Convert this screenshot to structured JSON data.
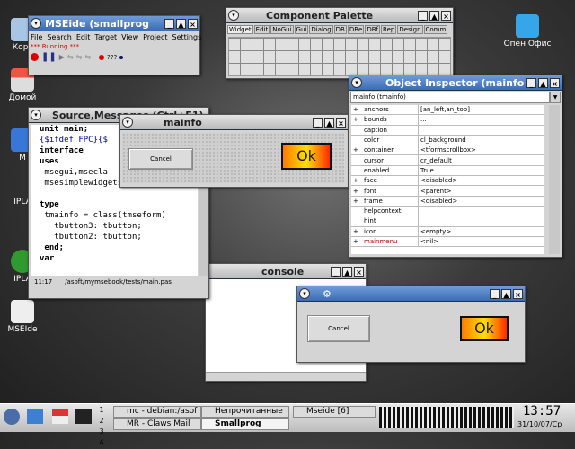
{
  "desktop": {
    "icons": [
      {
        "label": "Корз"
      },
      {
        "label": "Домой"
      },
      {
        "label": "M"
      },
      {
        "label": "IPLA"
      },
      {
        "label": "IPLA"
      },
      {
        "label": "MSEIde"
      },
      {
        "label": "Опен Офис"
      }
    ]
  },
  "mseide": {
    "title": "MSEide (smallprog",
    "menu": [
      "File",
      "Search",
      "Edit",
      "Target",
      "View",
      "Project",
      "Settings"
    ],
    "status": "*** Running ***",
    "toolbar_text": "???"
  },
  "palette": {
    "title": "Component Palette",
    "tabs": [
      "Widget",
      "Edit",
      "NoGui",
      "Gui",
      "Dialog",
      "DB",
      "DBe",
      "DBf",
      "Rep",
      "Design",
      "Comm"
    ]
  },
  "inspector": {
    "title": "Object Inspector (mainfo)",
    "selector": "mainfo (tmainfo)",
    "properties": [
      {
        "exp": "+",
        "name": "anchors",
        "value": "[an_left,an_top]"
      },
      {
        "exp": "+",
        "name": "bounds",
        "value": "..."
      },
      {
        "exp": "",
        "name": "caption",
        "value": ""
      },
      {
        "exp": "",
        "name": "color",
        "value": "cl_background"
      },
      {
        "exp": "+",
        "name": "container",
        "value": "<tformscrollbox>"
      },
      {
        "exp": "",
        "name": "cursor",
        "value": "cr_default"
      },
      {
        "exp": "",
        "name": "enabled",
        "value": "True"
      },
      {
        "exp": "+",
        "name": "face",
        "value": "<disabled>"
      },
      {
        "exp": "+",
        "name": "font",
        "value": "<parent>"
      },
      {
        "exp": "+",
        "name": "frame",
        "value": "<disabled>"
      },
      {
        "exp": "",
        "name": "helpcontext",
        "value": ""
      },
      {
        "exp": "",
        "name": "hint",
        "value": ""
      },
      {
        "exp": "+",
        "name": "icon",
        "value": "<empty>"
      },
      {
        "exp": "+",
        "name": "mainmenu",
        "value": "<nil>"
      }
    ]
  },
  "source": {
    "title": "Source,Messages (Ctrl+F1)",
    "lines": [
      {
        "text": "unit main;",
        "kw": true
      },
      {
        "text": "{$ifdef FPC}{$",
        "kw": false,
        "color": "#0000b0"
      },
      {
        "text": "interface",
        "kw": true
      },
      {
        "text": "uses",
        "kw": true
      },
      {
        "text": " msegui,msecla",
        "kw": false
      },
      {
        "text": " msesimplewidgets,msestrings",
        "kw": false
      },
      {
        "text": "",
        "kw": false
      },
      {
        "text": "type",
        "kw": true
      },
      {
        "text": " tmainfo = class(tmseform)",
        "kw": false
      },
      {
        "text": "   tbutton3: tbutton;",
        "kw": false
      },
      {
        "text": "   tbutton2: tbutton;",
        "kw": false
      },
      {
        "text": " end;",
        "kw": true
      },
      {
        "text": "var",
        "kw": true
      }
    ],
    "cursor_pos": "11:17",
    "path": "/asoft/mymsebook/tests/main.pas"
  },
  "mainfo": {
    "title": "mainfo",
    "cancel": "Cancel",
    "ok": "Ok"
  },
  "console": {
    "title": "console"
  },
  "runwin": {
    "cancel": "Cancel",
    "ok": "Ok"
  },
  "taskbar": {
    "desktops": [
      "1",
      "2",
      "3",
      "4"
    ],
    "tasks": [
      "mc - debian:/asof",
      "Непрочитанные",
      "Mseide [6]",
      "MR - Claws Mail",
      "Smallprog"
    ],
    "clock": "13:57",
    "date": "31/10/07/Ср"
  },
  "colors": {
    "titlebar": "#3a6bb6",
    "ok_gradient": "#ffe100"
  }
}
